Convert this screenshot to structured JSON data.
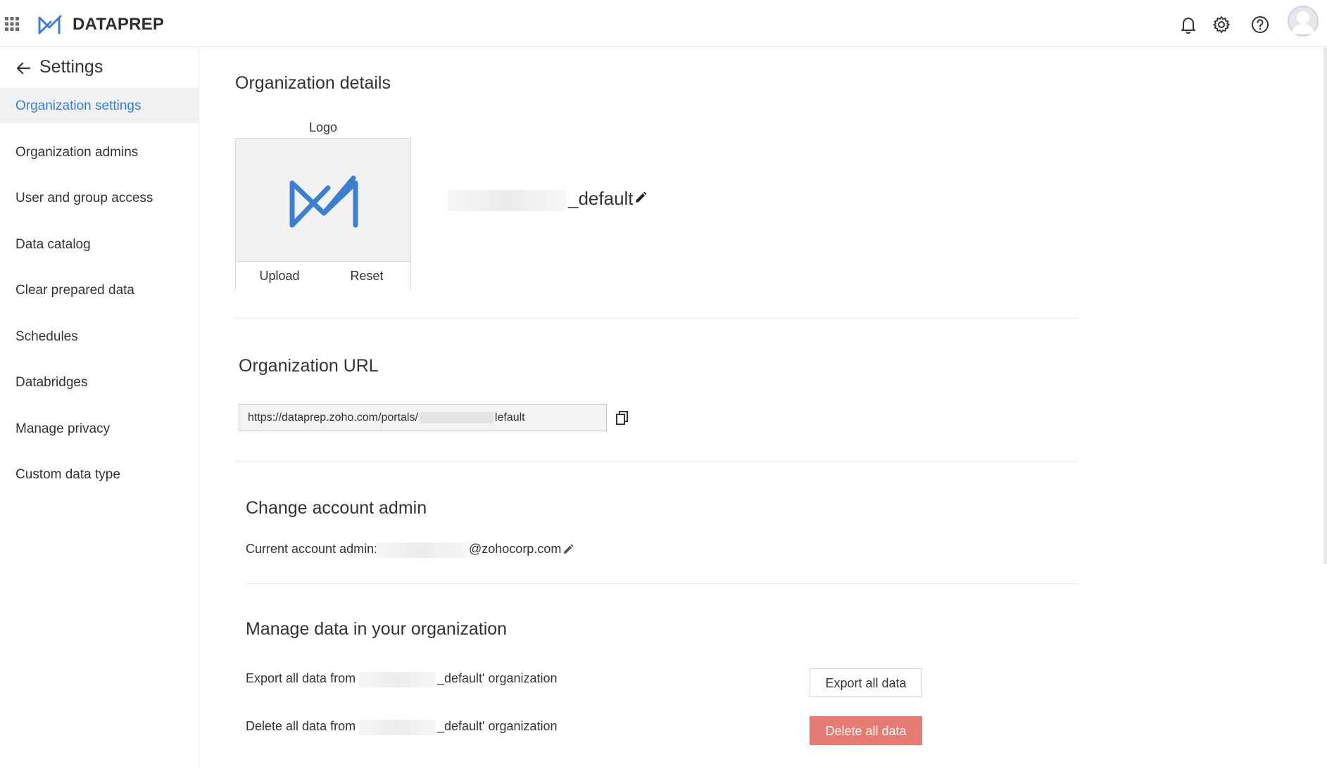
{
  "app": {
    "name": "DATAPREP",
    "brand_color": "#3b7fd3"
  },
  "topbar": {
    "icons": [
      "apps-grid-icon",
      "bell-icon",
      "gear-icon",
      "help-icon",
      "avatar"
    ]
  },
  "sidebar": {
    "back_icon": "arrow-left-icon",
    "title": "Settings",
    "active_color": "#3b7fd3",
    "items": [
      {
        "label": "Organization settings",
        "active": true
      },
      {
        "label": "Organization admins"
      },
      {
        "label": "User and group access"
      },
      {
        "label": "Data catalog"
      },
      {
        "label": "Clear prepared data"
      },
      {
        "label": "Schedules"
      },
      {
        "label": "Databridges"
      },
      {
        "label": "Manage privacy"
      },
      {
        "label": "Custom data type"
      }
    ]
  },
  "org_details": {
    "title": "Organization details",
    "logo_caption": "Logo",
    "upload_label": "Upload",
    "reset_label": "Reset",
    "org_name_suffix": "_default"
  },
  "org_url": {
    "title": "Organization URL",
    "url_prefix": "https://dataprep.zoho.com/portals/",
    "url_suffix": "lefault"
  },
  "account_admin": {
    "title": "Change account admin",
    "label": "Current account admin:",
    "email_suffix": "@zohocorp.com"
  },
  "manage_data": {
    "title": "Manage data in your organization",
    "export_prefix": "Export all data from '",
    "export_suffix": "_default' organization",
    "delete_prefix": "Delete all data from '",
    "delete_suffix": "_default' organization",
    "export_button": "Export all data",
    "delete_button": "Delete all data",
    "delete_color": "#e67b73"
  }
}
